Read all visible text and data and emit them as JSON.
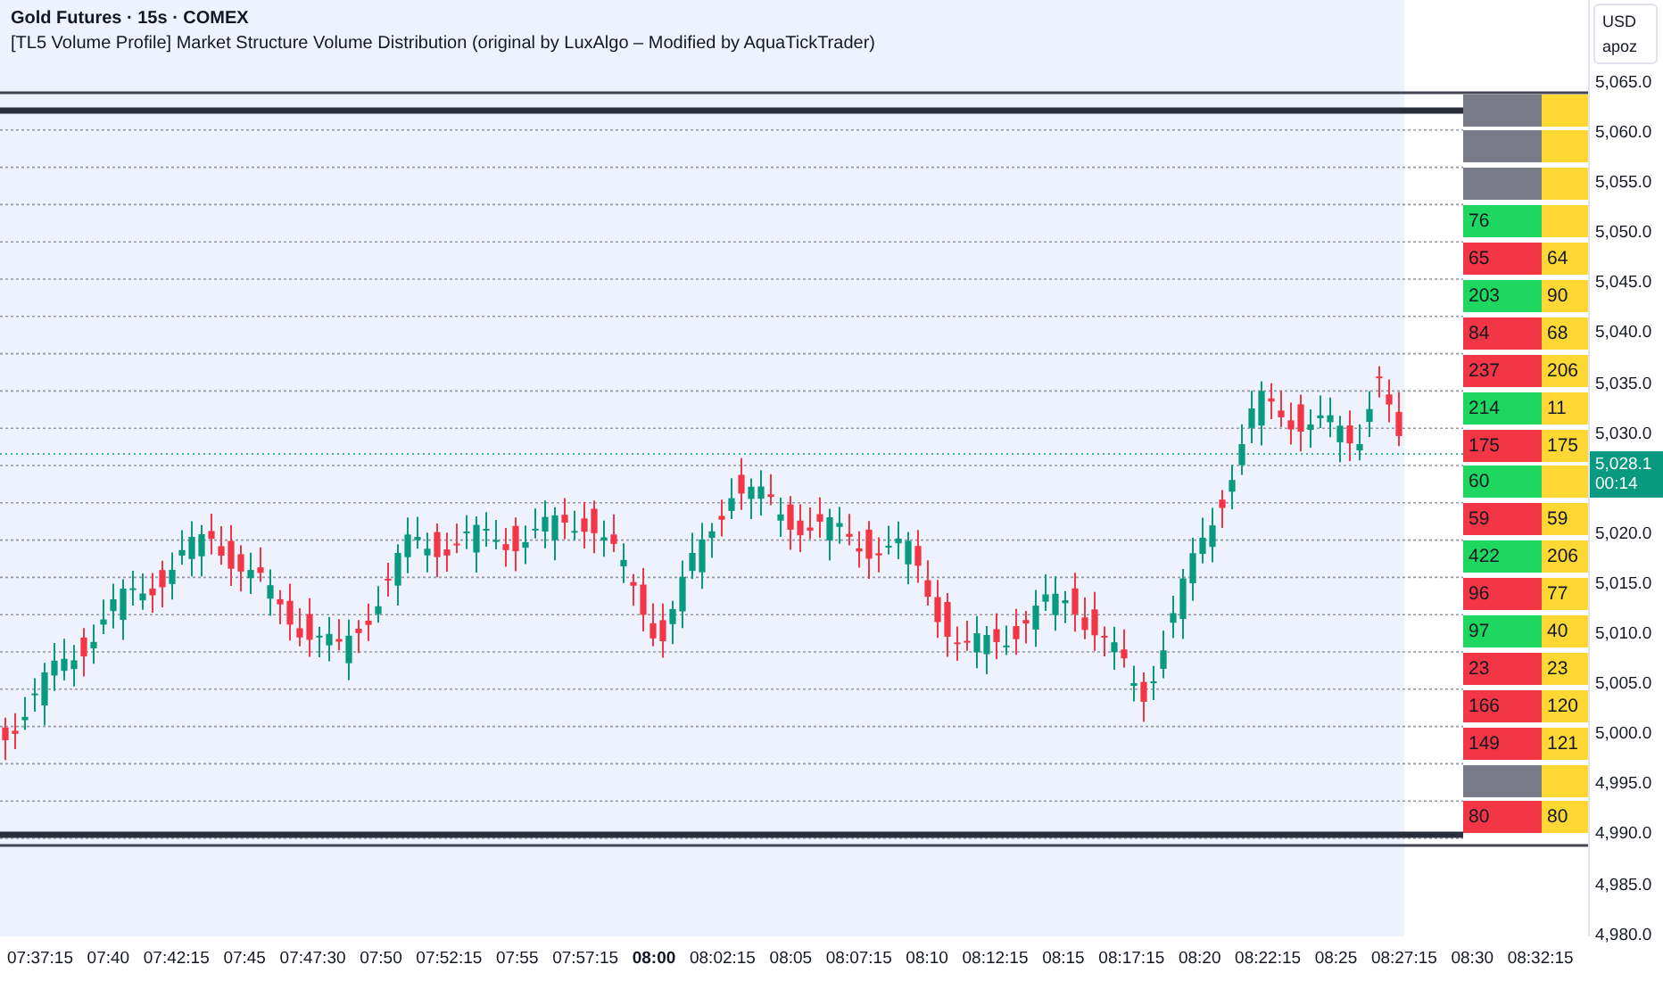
{
  "header": {
    "symbol": "Gold Futures · 15s · COMEX",
    "indicator": "[TL5 Volume Profile] Market Structure Volume Distribution (original by LuxAlgo – Modified by AquaTickTrader)"
  },
  "price_axis": {
    "currency": "USD",
    "unit": "apoz",
    "labels_above": [
      "5,065.0",
      "5,060.0",
      "5,055.0",
      "5,050.0",
      "5,045.0",
      "5,040.0",
      "5,035.0",
      "5,030.0"
    ],
    "labels_below": [
      "5,020.0",
      "5,015.0",
      "5,010.0",
      "5,005.0",
      "5,000.0",
      "4,995.0",
      "4,990.0",
      "4,985.0",
      "4,980.0"
    ],
    "last_price": "5,028.1",
    "countdown": "00:14"
  },
  "profile_rows": [
    {
      "color": "#787b86"
    },
    {
      "color": "#787b86"
    },
    {
      "color": "#787b86"
    },
    {
      "color": "#1ed760",
      "volume": "76"
    },
    {
      "color": "#f23645",
      "volume": "65",
      "delta": "64"
    },
    {
      "color": "#1ed760",
      "volume": "203",
      "delta": "90"
    },
    {
      "color": "#f23645",
      "volume": "84",
      "delta": "68"
    },
    {
      "color": "#f23645",
      "volume": "237",
      "delta": "206"
    },
    {
      "color": "#1ed760",
      "volume": "214",
      "delta": "11"
    },
    {
      "color": "#f23645",
      "volume": "175",
      "delta": "175"
    },
    {
      "color": "#1ed760",
      "volume": "60"
    },
    {
      "color": "#f23645",
      "volume": "59",
      "delta": "59"
    },
    {
      "color": "#1ed760",
      "volume": "422",
      "delta": "206"
    },
    {
      "color": "#f23645",
      "volume": "96",
      "delta": "77"
    },
    {
      "color": "#1ed760",
      "volume": "97",
      "delta": "40"
    },
    {
      "color": "#f23645",
      "volume": "23",
      "delta": "23"
    },
    {
      "color": "#f23645",
      "volume": "166",
      "delta": "120"
    },
    {
      "color": "#f23645",
      "volume": "149",
      "delta": "121"
    },
    {
      "color": "#787b86"
    },
    {
      "color": "#f23645",
      "volume": "80",
      "delta": "80"
    }
  ],
  "time_axis": [
    {
      "label": "07:37:15",
      "selected": false
    },
    {
      "label": "07:40",
      "selected": false
    },
    {
      "label": "07:42:15",
      "selected": false
    },
    {
      "label": "07:45",
      "selected": false
    },
    {
      "label": "07:47:30",
      "selected": false
    },
    {
      "label": "07:50",
      "selected": false
    },
    {
      "label": "07:52:15",
      "selected": false
    },
    {
      "label": "07:55",
      "selected": false
    },
    {
      "label": "07:57:15",
      "selected": false
    },
    {
      "label": "08:00",
      "selected": true
    },
    {
      "label": "08:02:15",
      "selected": false
    },
    {
      "label": "08:05",
      "selected": false
    },
    {
      "label": "08:07:15",
      "selected": false
    },
    {
      "label": "08:10",
      "selected": false
    },
    {
      "label": "08:12:15",
      "selected": false
    },
    {
      "label": "08:15",
      "selected": false
    },
    {
      "label": "08:17:15",
      "selected": false
    },
    {
      "label": "08:20",
      "selected": false
    },
    {
      "label": "08:22:15",
      "selected": false
    },
    {
      "label": "08:25",
      "selected": false
    },
    {
      "label": "08:27:15",
      "selected": false
    },
    {
      "label": "08:30",
      "selected": false
    },
    {
      "label": "08:32:15",
      "selected": false
    }
  ]
}
